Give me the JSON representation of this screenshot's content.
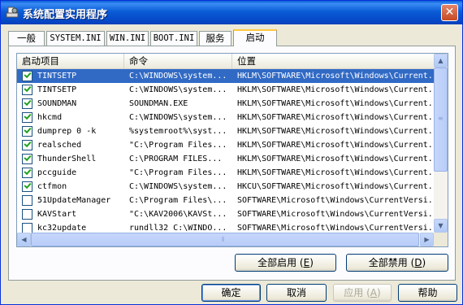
{
  "window": {
    "title": "系统配置实用程序",
    "close_label": "✕"
  },
  "tabs": [
    {
      "label": "一般"
    },
    {
      "label": "SYSTEM.INI"
    },
    {
      "label": "WIN.INI"
    },
    {
      "label": "BOOT.INI"
    },
    {
      "label": "服务"
    },
    {
      "label": "启动"
    }
  ],
  "active_tab": "启动",
  "list": {
    "columns": [
      "启动项目",
      "命令",
      "位置"
    ],
    "rows": [
      {
        "checked": true,
        "selected": true,
        "item": "TINTSETP",
        "command": "C:\\WINDOWS\\system...",
        "location": "HKLM\\SOFTWARE\\Microsoft\\Windows\\Current..."
      },
      {
        "checked": true,
        "selected": false,
        "item": "TINTSETP",
        "command": "C:\\WINDOWS\\system...",
        "location": "HKLM\\SOFTWARE\\Microsoft\\Windows\\Current..."
      },
      {
        "checked": true,
        "selected": false,
        "item": "SOUNDMAN",
        "command": "SOUNDMAN.EXE",
        "location": "HKLM\\SOFTWARE\\Microsoft\\Windows\\Current..."
      },
      {
        "checked": true,
        "selected": false,
        "item": "hkcmd",
        "command": "C:\\WINDOWS\\system...",
        "location": "HKLM\\SOFTWARE\\Microsoft\\Windows\\Current..."
      },
      {
        "checked": true,
        "selected": false,
        "item": "dumprep 0 -k",
        "command": "%systemroot%\\syst...",
        "location": "HKLM\\SOFTWARE\\Microsoft\\Windows\\Current..."
      },
      {
        "checked": true,
        "selected": false,
        "item": "realsched",
        "command": "\"C:\\Program Files...",
        "location": "HKLM\\SOFTWARE\\Microsoft\\Windows\\Current..."
      },
      {
        "checked": true,
        "selected": false,
        "item": "ThunderShell",
        "command": "C:\\PROGRAM FILES...",
        "location": "HKLM\\SOFTWARE\\Microsoft\\Windows\\Current..."
      },
      {
        "checked": true,
        "selected": false,
        "item": "pccguide",
        "command": "\"C:\\Program Files...",
        "location": "HKLM\\SOFTWARE\\Microsoft\\Windows\\Current..."
      },
      {
        "checked": true,
        "selected": false,
        "item": "ctfmon",
        "command": "C:\\WINDOWS\\system...",
        "location": "HKCU\\SOFTWARE\\Microsoft\\Windows\\Current..."
      },
      {
        "checked": false,
        "selected": false,
        "item": "51UpdateManager",
        "command": "C:\\Program Files\\...",
        "location": "SOFTWARE\\Microsoft\\Windows\\CurrentVersi..."
      },
      {
        "checked": false,
        "selected": false,
        "item": "KAVStart",
        "command": "\"C:\\KAV2006\\KAVSt...",
        "location": "SOFTWARE\\Microsoft\\Windows\\CurrentVersi..."
      },
      {
        "checked": false,
        "selected": false,
        "item": "kc32update",
        "command": "rundll32 C:\\WINDO...",
        "location": "SOFTWARE\\Microsoft\\Windows\\CurrentVersi..."
      }
    ]
  },
  "buttons": {
    "enable_all": {
      "text": "全部启用 (",
      "key": "E",
      "end": ")"
    },
    "disable_all": {
      "text": "全部禁用 (",
      "key": "D",
      "end": ")"
    },
    "ok": "确定",
    "cancel": "取消",
    "apply": {
      "text": "应用 (",
      "key": "A",
      "end": ")"
    },
    "help": "帮助"
  },
  "icons": {
    "title": "gear-monitor-icon",
    "checkbox_tick": "check-icon"
  }
}
